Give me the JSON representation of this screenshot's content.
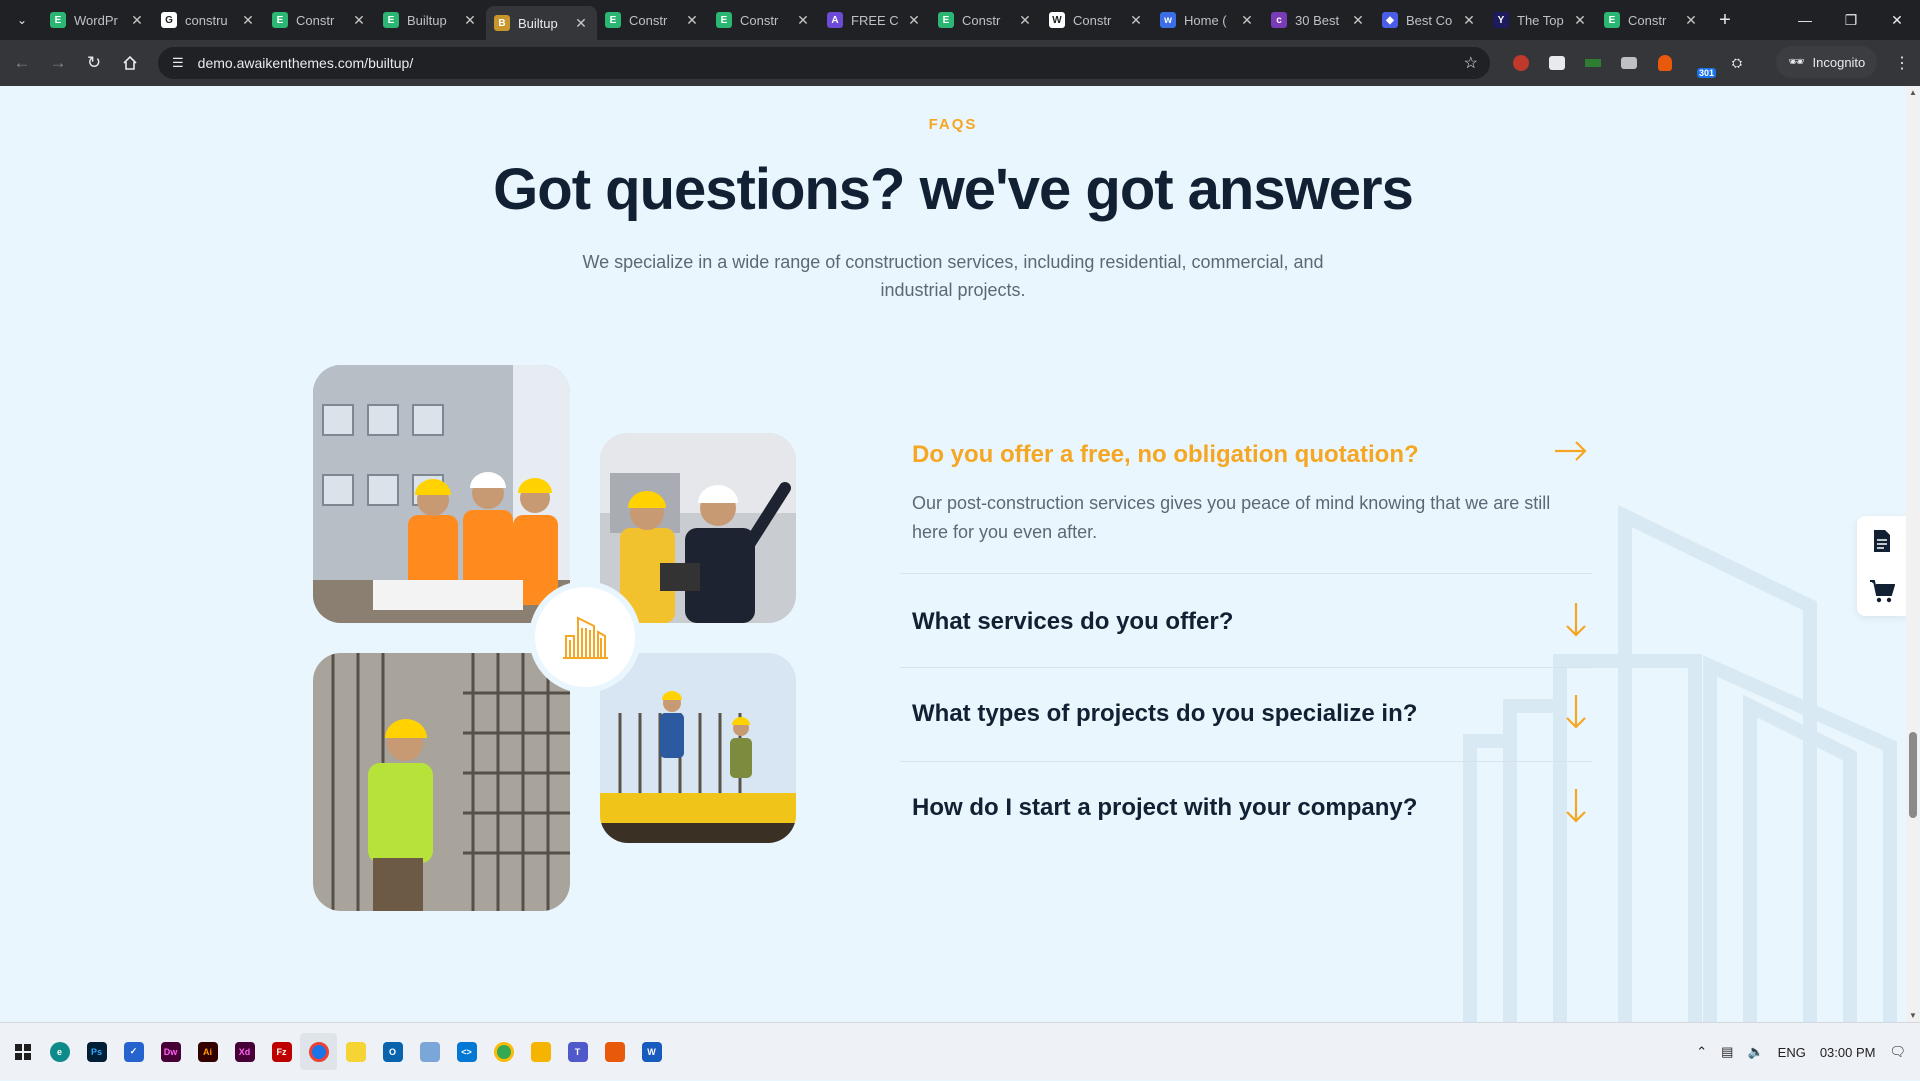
{
  "browser": {
    "tabs": [
      {
        "label": "WordPr",
        "fav_color": "#2bb673",
        "fav_text": "E"
      },
      {
        "label": "constru",
        "fav_color": "#ffffff",
        "fav_text": "G"
      },
      {
        "label": "Constr",
        "fav_color": "#2bb673",
        "fav_text": "E"
      },
      {
        "label": "Builtup",
        "fav_color": "#2bb673",
        "fav_text": "E"
      },
      {
        "label": "Builtup",
        "fav_color": "#c8962a",
        "fav_text": "B"
      },
      {
        "label": "Constr",
        "fav_color": "#2bb673",
        "fav_text": "E"
      },
      {
        "label": "Constr",
        "fav_color": "#2bb673",
        "fav_text": "E"
      },
      {
        "label": "FREE C",
        "fav_color": "#6c4bd6",
        "fav_text": "A"
      },
      {
        "label": "Constr",
        "fav_color": "#2bb673",
        "fav_text": "E"
      },
      {
        "label": "Constr",
        "fav_color": "#ffffff",
        "fav_text": "W"
      },
      {
        "label": "Home (",
        "fav_color": "#3b6ee8",
        "fav_text": "w"
      },
      {
        "label": "30 Best",
        "fav_color": "#7a3bb8",
        "fav_text": "c"
      },
      {
        "label": "Best Co",
        "fav_color": "#4b5de8",
        "fav_text": "◆"
      },
      {
        "label": "The Top",
        "fav_color": "#1d1b5e",
        "fav_text": "Y"
      },
      {
        "label": "Constr",
        "fav_color": "#2bb673",
        "fav_text": "E"
      }
    ],
    "url": "demo.awaikenthemes.com/builtup/",
    "incognito_label": "Incognito",
    "ext_badge": "301"
  },
  "faq_section": {
    "eyebrow": "FAQS",
    "headline": "Got questions? we've got answers",
    "subtext": "We specialize in a wide range of construction services, including residential, commercial, and industrial projects.",
    "items": [
      {
        "question": "Do you offer a free, no obligation quotation?",
        "answer": "Our post-construction services gives you peace of mind knowing that we are still here for you even after.",
        "open": true
      },
      {
        "question": "What services do you offer?",
        "open": false
      },
      {
        "question": "What types of projects do you specialize in?",
        "open": false
      },
      {
        "question": "How do I start a project with your company?",
        "open": false
      }
    ]
  },
  "colors": {
    "accent": "#f5a623",
    "heading": "#122033",
    "body_text": "#5d6876",
    "page_bg": "#eaf6fd"
  },
  "taskbar": {
    "language": "ENG",
    "time": "03:00 PM"
  }
}
